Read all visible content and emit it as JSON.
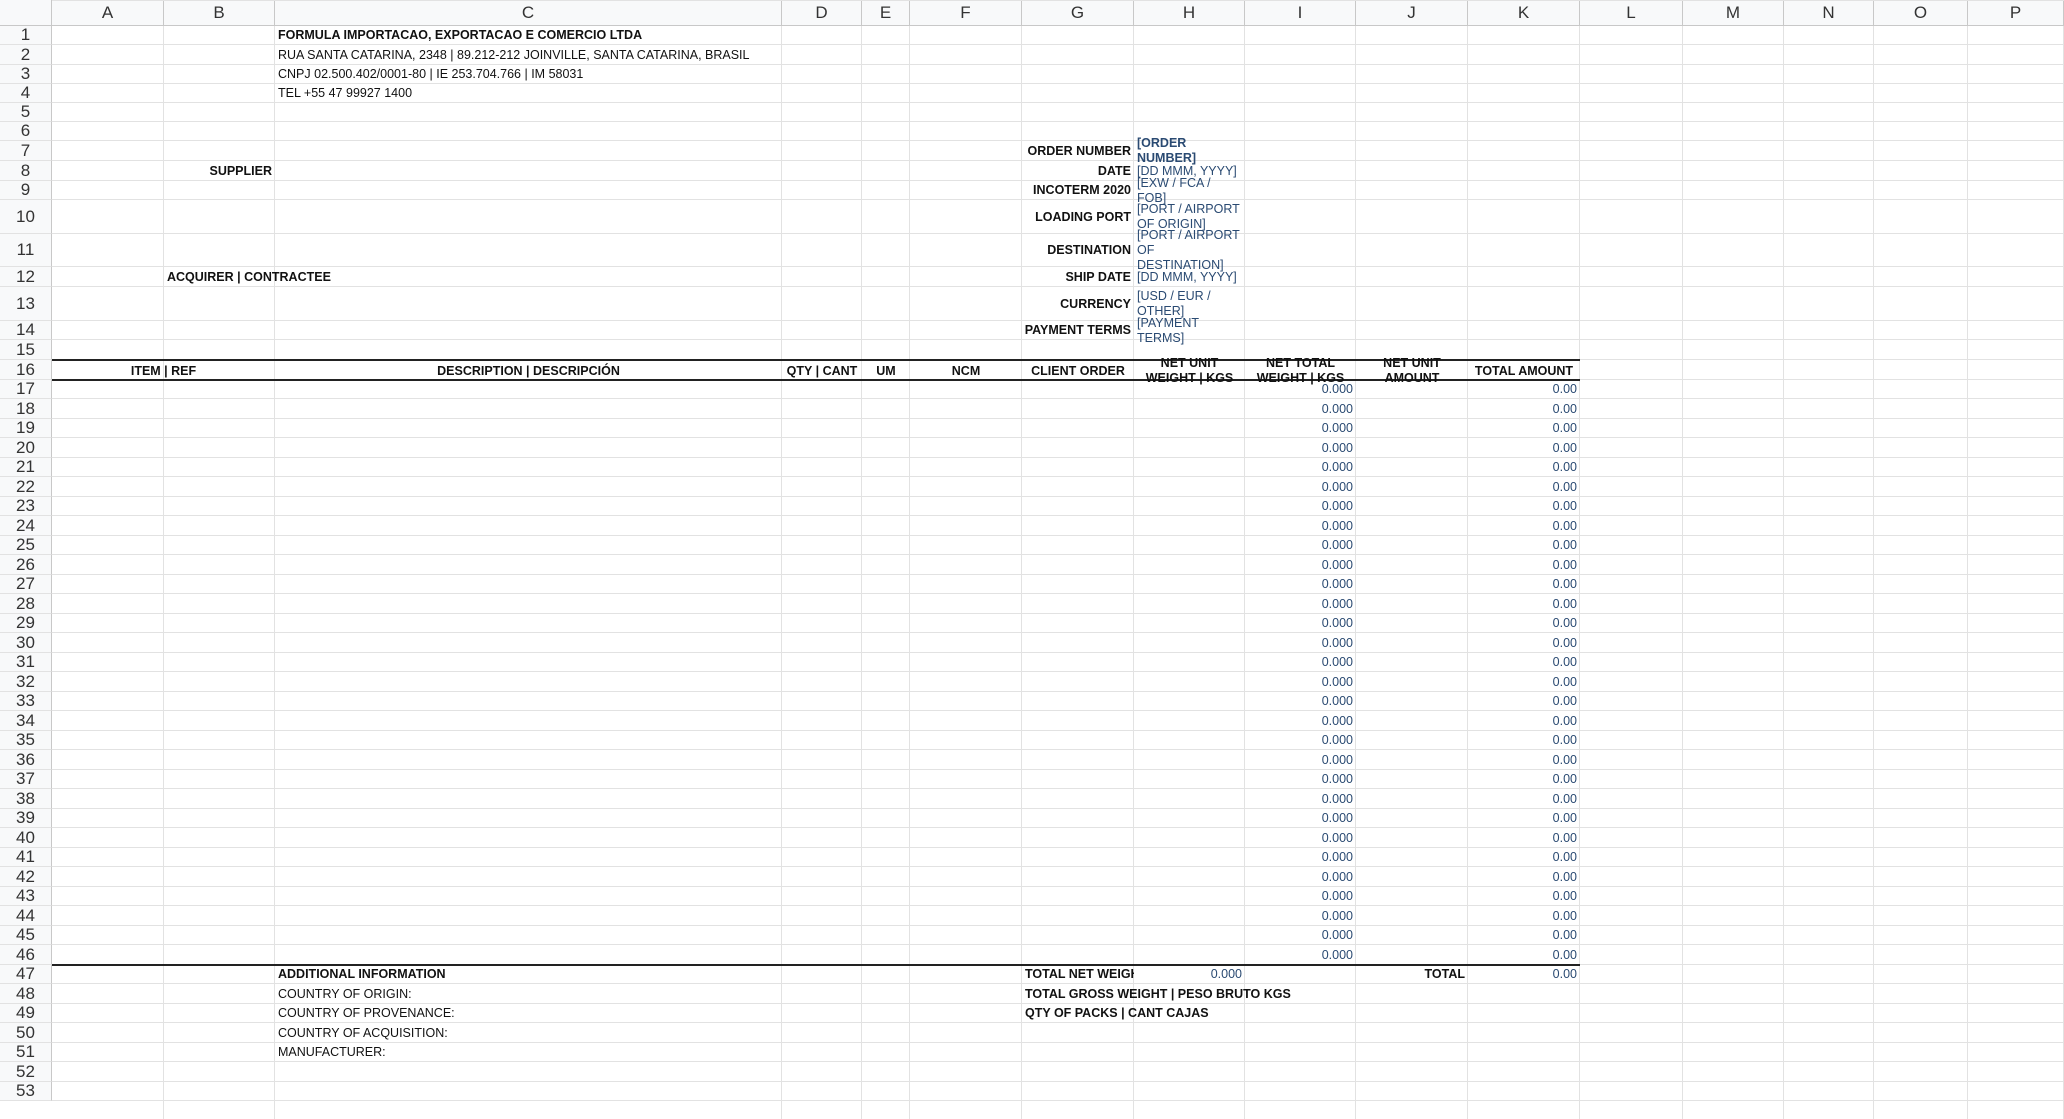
{
  "columns": [
    "A",
    "B",
    "C",
    "D",
    "E",
    "F",
    "G",
    "H",
    "I",
    "J",
    "K",
    "L",
    "M",
    "N",
    "O",
    "P"
  ],
  "rows": [
    "1",
    "2",
    "3",
    "4",
    "5",
    "6",
    "7",
    "8",
    "9",
    "10",
    "11",
    "12",
    "13",
    "14",
    "15",
    "16",
    "17",
    "18",
    "19",
    "20",
    "21",
    "22",
    "23",
    "24",
    "25",
    "26",
    "27",
    "28",
    "29",
    "30",
    "31",
    "32",
    "33",
    "34",
    "35",
    "36",
    "37",
    "38",
    "39",
    "40",
    "41",
    "42",
    "43",
    "44",
    "45",
    "46",
    "47",
    "48",
    "49",
    "50",
    "51",
    "52",
    "53"
  ],
  "company": {
    "name": "FORMULA IMPORTACAO, EXPORTACAO E COMERCIO LTDA",
    "address": "RUA SANTA CATARINA, 2348 | 89.212-212 JOINVILLE, SANTA CATARINA, BRASIL",
    "registration": "CNPJ 02.500.402/0001-80 | IE 253.704.766 | IM 58031",
    "phone": "TEL +55 47 99927 1400"
  },
  "parties": {
    "supplier": "SUPPLIER",
    "acquirer": "ACQUIRER | CONTRACTEE"
  },
  "order": [
    {
      "label": "ORDER NUMBER",
      "value": "[ORDER NUMBER]"
    },
    {
      "label": "DATE",
      "value": "[DD MMM, YYYY]"
    },
    {
      "label": "INCOTERM 2020",
      "value": "[EXW / FCA / FOB]"
    },
    {
      "label": "LOADING PORT",
      "value": "[PORT / AIRPORT OF ORIGIN]"
    },
    {
      "label": "DESTINATION",
      "value": "[PORT / AIRPORT OF DESTINATION]"
    },
    {
      "label": "SHIP DATE",
      "value": "[DD MMM, YYYY]"
    },
    {
      "label": "CURRENCY",
      "value": "[USD / EUR / OTHER]"
    },
    {
      "label": "PAYMENT TERMS",
      "value": "[PAYMENT TERMS]"
    }
  ],
  "table_headers": {
    "item": "ITEM | REF",
    "description": "DESCRIPTION | DESCRIPCIÓN",
    "qty": "QTY | CANT",
    "um": "UM",
    "ncm": "NCM",
    "client_order": "CLIENT ORDER",
    "net_unit_weight": "NET UNIT WEIGHT | KGS",
    "net_total_weight": "NET TOTAL WEIGHT | KGS",
    "net_unit_amount": "NET UNIT AMOUNT",
    "total_amount": "TOTAL AMOUNT"
  },
  "line_items": {
    "weight": [
      "0.000",
      "0.000",
      "0.000",
      "0.000",
      "0.000",
      "0.000",
      "0.000",
      "0.000",
      "0.000",
      "0.000",
      "0.000",
      "0.000",
      "0.000",
      "0.000",
      "0.000",
      "0.000",
      "0.000",
      "0.000",
      "0.000",
      "0.000",
      "0.000",
      "0.000",
      "0.000",
      "0.000",
      "0.000",
      "0.000",
      "0.000",
      "0.000",
      "0.000",
      "0.000"
    ],
    "amount": [
      "0.00",
      "0.00",
      "0.00",
      "0.00",
      "0.00",
      "0.00",
      "0.00",
      "0.00",
      "0.00",
      "0.00",
      "0.00",
      "0.00",
      "0.00",
      "0.00",
      "0.00",
      "0.00",
      "0.00",
      "0.00",
      "0.00",
      "0.00",
      "0.00",
      "0.00",
      "0.00",
      "0.00",
      "0.00",
      "0.00",
      "0.00",
      "0.00",
      "0.00",
      "0.00"
    ]
  },
  "additional": {
    "title": "ADDITIONAL INFORMATION",
    "origin": "COUNTRY OF ORIGIN:",
    "provenance": "COUNTRY OF PROVENANCE:",
    "acquisition": "COUNTRY OF ACQUISITION:",
    "manufacturer": "MANUFACTURER:"
  },
  "totals": {
    "net_weight_label": "TOTAL NET WEIGHT",
    "net_weight_value": "0.000",
    "total_label": "TOTAL",
    "total_value": "0.00",
    "gross_weight_label": "TOTAL GROSS WEIGHT | PESO BRUTO KGS",
    "packs_label": "QTY OF PACKS | CANT CAJAS"
  }
}
